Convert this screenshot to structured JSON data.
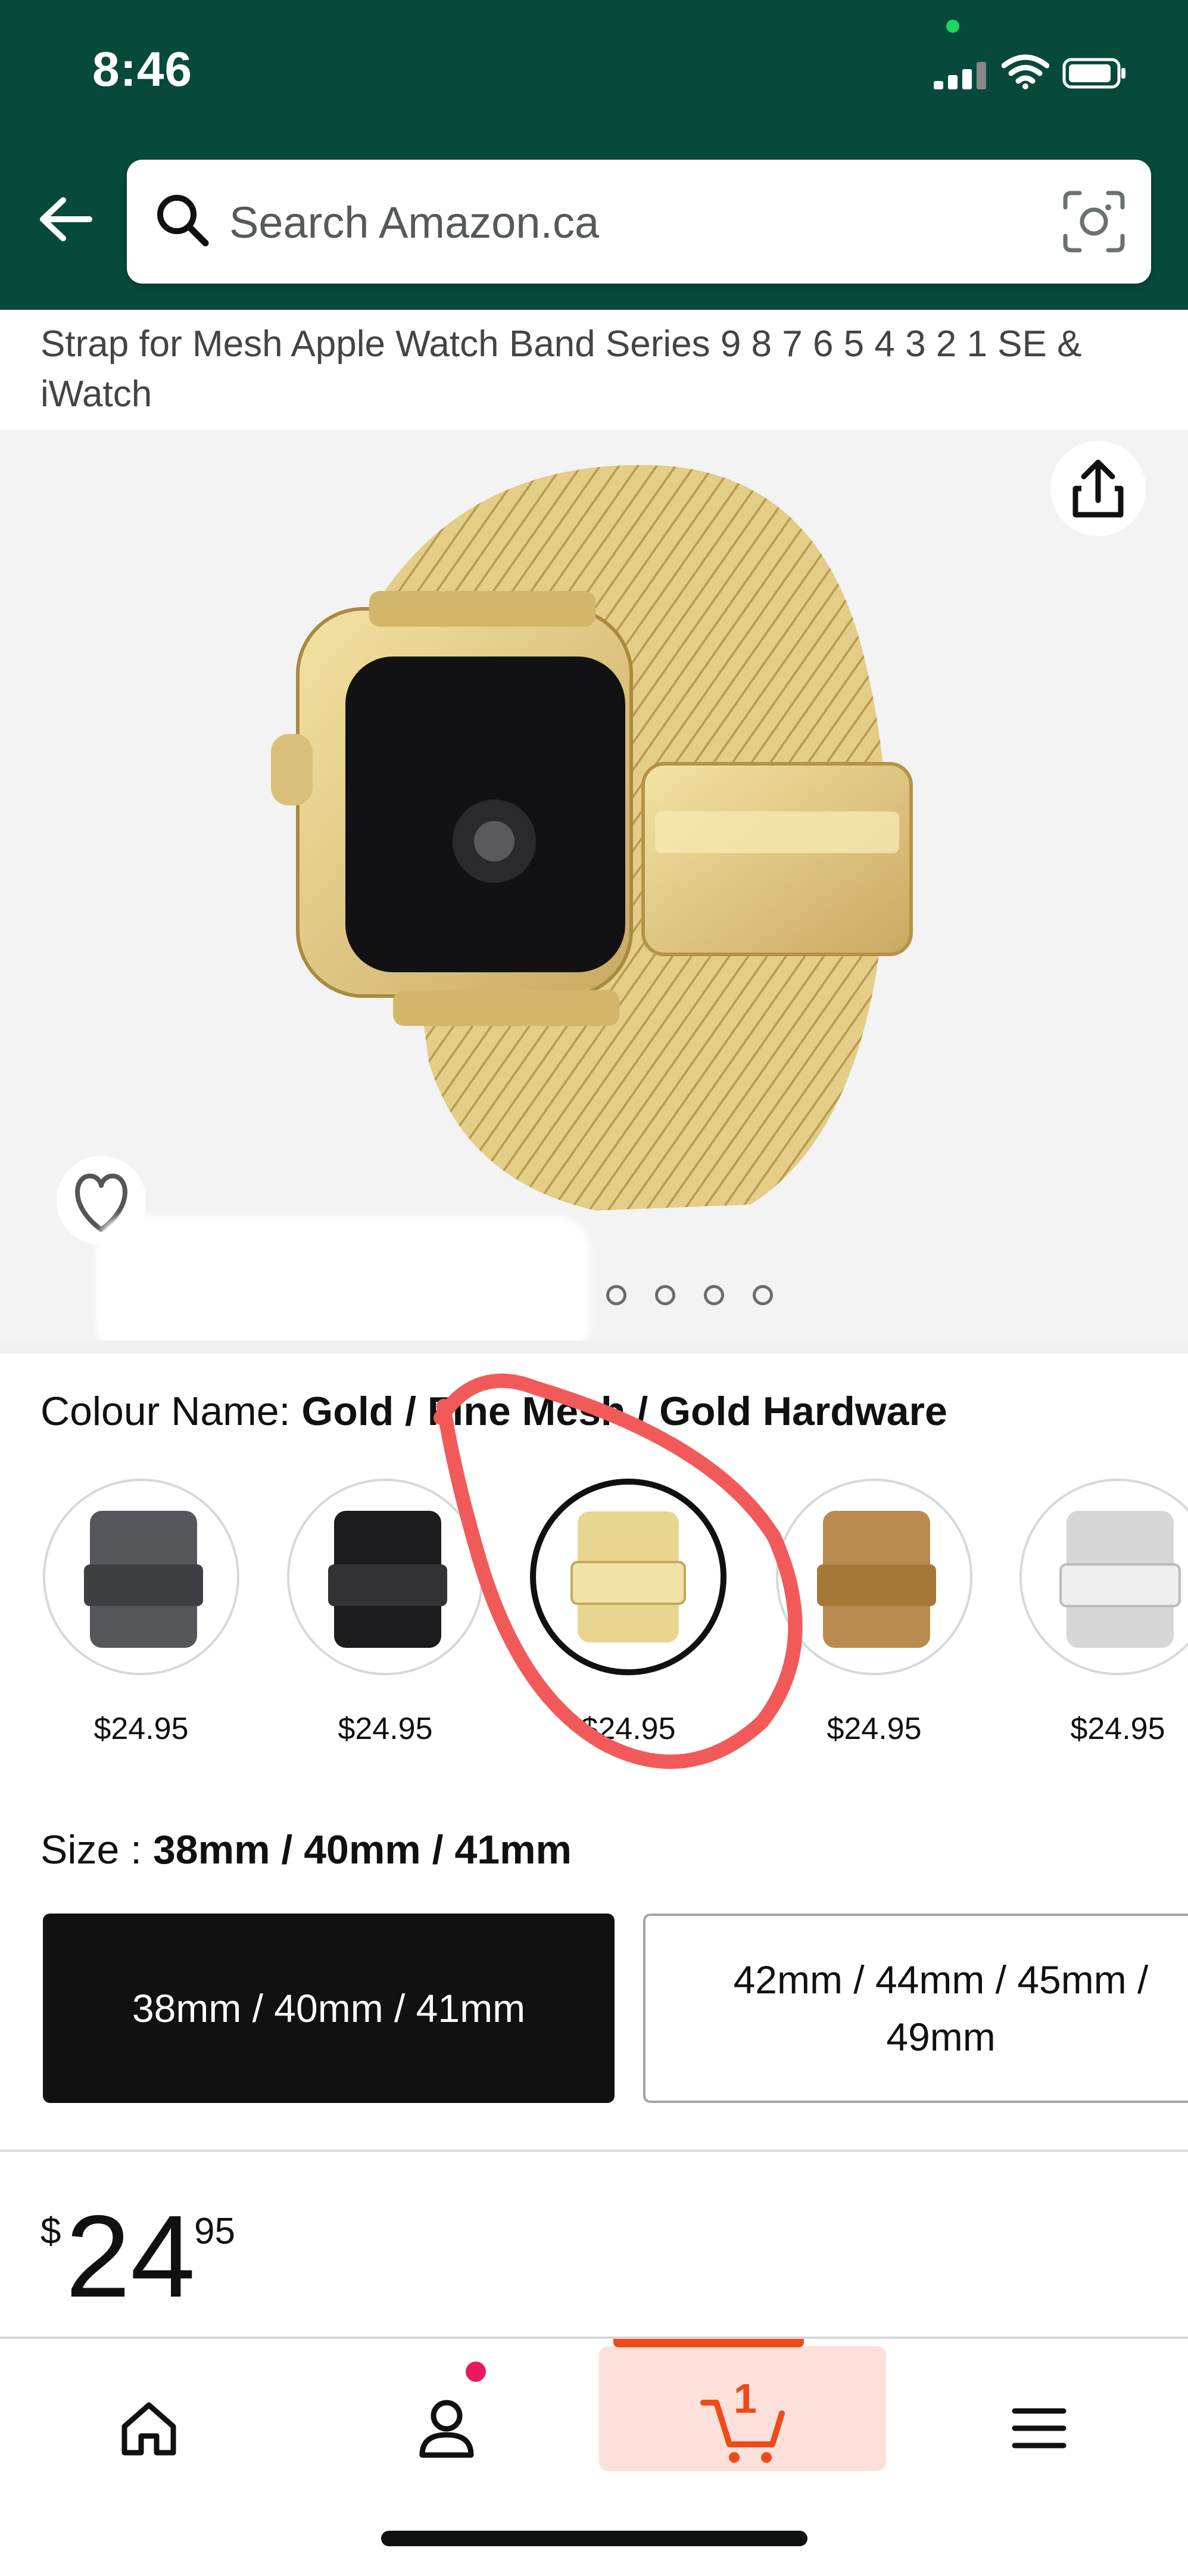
{
  "status_bar": {
    "time": "8:46"
  },
  "search": {
    "placeholder": "Search Amazon.ca"
  },
  "product": {
    "title": "Strap for Mesh Apple Watch Band Series 9 8 7 6 5 4 3 2 1 SE & iWatch",
    "image_alt": "Gold mesh watch band"
  },
  "colour": {
    "label": "Colour Name: ",
    "selected": "Gold / Fine Mesh / Gold Hardware",
    "options": [
      {
        "color": "#55575a",
        "price": "$24.95"
      },
      {
        "color": "#1c1c1e",
        "price": "$24.95"
      },
      {
        "color": "#e8d58f",
        "price": "$24.95",
        "selected": true
      },
      {
        "color": "#b98b4e",
        "price": "$24.95"
      },
      {
        "color": "#d7d7d7",
        "price": "$24.95"
      }
    ]
  },
  "size": {
    "label": "Size : ",
    "selected": "38mm / 40mm / 41mm",
    "options": [
      "38mm / 40mm / 41mm",
      "42mm / 44mm / 45mm / 49mm"
    ]
  },
  "price": {
    "symbol": "$",
    "whole": "24",
    "fraction": "95"
  },
  "nav": {
    "cart_count": "1"
  },
  "colors": {
    "header": "#074a3c",
    "accent": "#f04a18",
    "annotation": "#f25a5a"
  }
}
